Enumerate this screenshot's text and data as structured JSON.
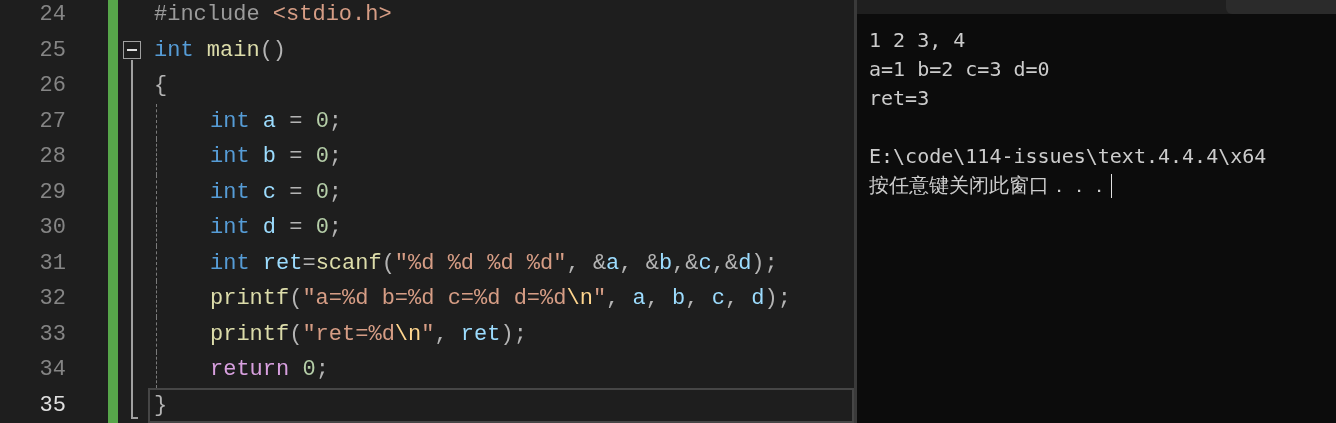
{
  "editor": {
    "lines": [
      {
        "number": "24",
        "current": false,
        "tokens": [
          {
            "kind": "preproc",
            "text": "#include"
          },
          {
            "kind": "string",
            "text": " <stdio.h>"
          }
        ]
      },
      {
        "number": "25",
        "current": false,
        "fold": {
          "expanded": true
        },
        "tokens": [
          {
            "kind": "keyword",
            "text": "int"
          },
          {
            "kind": "function",
            "text": " main"
          },
          {
            "kind": "plain",
            "text": "()"
          }
        ]
      },
      {
        "number": "26",
        "current": false,
        "tokens": [
          {
            "kind": "plain",
            "text": "{"
          }
        ],
        "children": [
          {
            "number": "27",
            "current": false,
            "tokens": [
              {
                "kind": "keyword",
                "text": "int"
              },
              {
                "kind": "variable",
                "text": " a"
              },
              {
                "kind": "plain",
                "text": " = "
              },
              {
                "kind": "number",
                "text": "0"
              },
              {
                "kind": "plain",
                "text": ";"
              }
            ]
          },
          {
            "number": "28",
            "current": false,
            "tokens": [
              {
                "kind": "keyword",
                "text": "int"
              },
              {
                "kind": "variable",
                "text": " b"
              },
              {
                "kind": "plain",
                "text": " = "
              },
              {
                "kind": "number",
                "text": "0"
              },
              {
                "kind": "plain",
                "text": ";"
              }
            ]
          },
          {
            "number": "29",
            "current": false,
            "tokens": [
              {
                "kind": "keyword",
                "text": "int"
              },
              {
                "kind": "variable",
                "text": " c"
              },
              {
                "kind": "plain",
                "text": " = "
              },
              {
                "kind": "number",
                "text": "0"
              },
              {
                "kind": "plain",
                "text": ";"
              }
            ]
          },
          {
            "number": "30",
            "current": false,
            "tokens": [
              {
                "kind": "keyword",
                "text": "int"
              },
              {
                "kind": "variable",
                "text": " d"
              },
              {
                "kind": "plain",
                "text": " = "
              },
              {
                "kind": "number",
                "text": "0"
              },
              {
                "kind": "plain",
                "text": ";"
              }
            ]
          },
          {
            "number": "31",
            "current": false,
            "tokens": [
              {
                "kind": "keyword",
                "text": "int"
              },
              {
                "kind": "variable",
                "text": " ret"
              },
              {
                "kind": "plain",
                "text": "="
              },
              {
                "kind": "function",
                "text": "scanf"
              },
              {
                "kind": "plain",
                "text": "("
              },
              {
                "kind": "string",
                "text": "\"%d %d %d %d\""
              },
              {
                "kind": "plain",
                "text": ", &"
              },
              {
                "kind": "variable",
                "text": "a"
              },
              {
                "kind": "plain",
                "text": ", &"
              },
              {
                "kind": "variable",
                "text": "b"
              },
              {
                "kind": "plain",
                "text": ",&"
              },
              {
                "kind": "variable",
                "text": "c"
              },
              {
                "kind": "plain",
                "text": ",&"
              },
              {
                "kind": "variable",
                "text": "d"
              },
              {
                "kind": "plain",
                "text": ");"
              }
            ]
          },
          {
            "number": "32",
            "current": false,
            "tokens": [
              {
                "kind": "function",
                "text": "printf"
              },
              {
                "kind": "plain",
                "text": "("
              },
              {
                "kind": "string",
                "text": "\"a=%d b=%d c=%d d=%d"
              },
              {
                "kind": "escape",
                "text": "\\n"
              },
              {
                "kind": "string",
                "text": "\""
              },
              {
                "kind": "plain",
                "text": ", "
              },
              {
                "kind": "variable",
                "text": "a"
              },
              {
                "kind": "plain",
                "text": ", "
              },
              {
                "kind": "variable",
                "text": "b"
              },
              {
                "kind": "plain",
                "text": ", "
              },
              {
                "kind": "variable",
                "text": "c"
              },
              {
                "kind": "plain",
                "text": ", "
              },
              {
                "kind": "variable",
                "text": "d"
              },
              {
                "kind": "plain",
                "text": ");"
              }
            ]
          },
          {
            "number": "33",
            "current": false,
            "tokens": [
              {
                "kind": "function",
                "text": "printf"
              },
              {
                "kind": "plain",
                "text": "("
              },
              {
                "kind": "string",
                "text": "\"ret=%d"
              },
              {
                "kind": "escape",
                "text": "\\n"
              },
              {
                "kind": "string",
                "text": "\""
              },
              {
                "kind": "plain",
                "text": ", "
              },
              {
                "kind": "variable",
                "text": "ret"
              },
              {
                "kind": "plain",
                "text": ");"
              }
            ]
          },
          {
            "number": "34",
            "current": false,
            "tokens": [
              {
                "kind": "control",
                "text": "return"
              },
              {
                "kind": "number",
                "text": " 0"
              },
              {
                "kind": "plain",
                "text": ";"
              }
            ]
          }
        ]
      },
      {
        "number": "35",
        "current": true,
        "tokens": [
          {
            "kind": "plain",
            "text": "}"
          }
        ]
      }
    ]
  },
  "console": {
    "lines": [
      "1 2 3, 4",
      "a=1 b=2 c=3 d=0",
      "ret=3",
      "E:\\code\\114-issues\\text.4.4.4\\x64",
      "按任意键关闭此窗口．．．"
    ]
  }
}
